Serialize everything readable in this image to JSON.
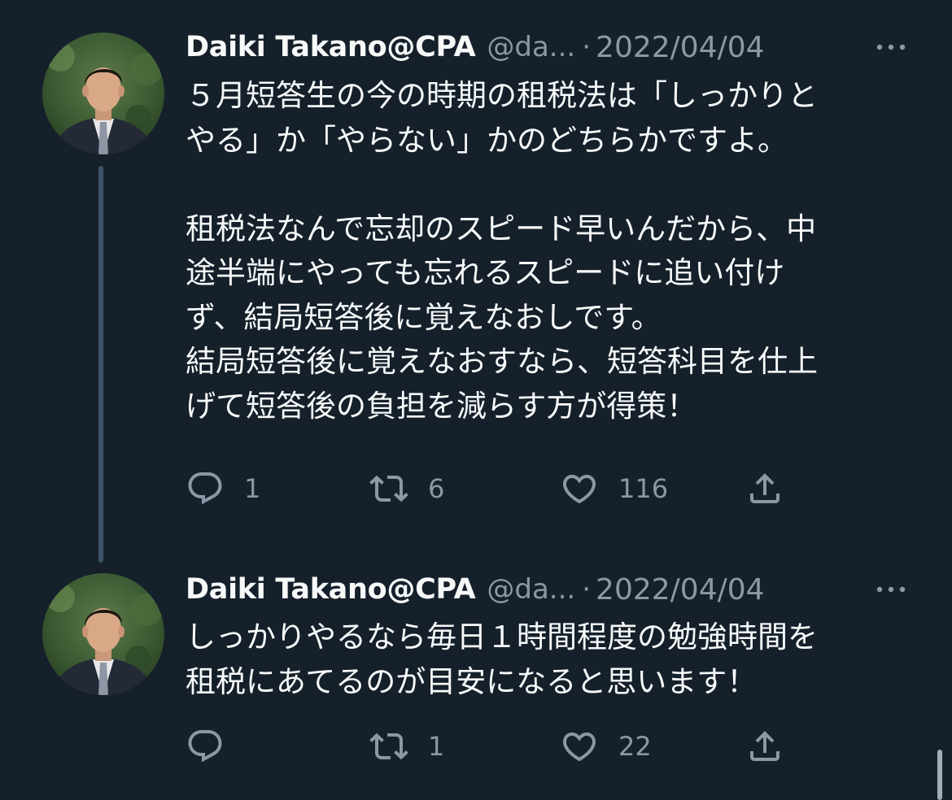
{
  "tweets": [
    {
      "author": {
        "display_name": "Daiki Takano@CPA",
        "handle": "@da...",
        "avatar_icon": "avatar-photo"
      },
      "separator": "·",
      "date": "2022/04/04",
      "text": "５月短答生の今の時期の租税法は「しっかりと\nやる」か「やらない」かのどちらかですよ。\n\n租税法なんで忘却のスピード早いんだから、中\n途半端にやっても忘れるスピードに追い付け\nず、結局短答後に覚えなおしです。\n結局短答後に覚えなおすなら、短答科目を仕上\nげて短答後の負担を減らす方が得策！",
      "replies": "1",
      "retweets": "6",
      "likes": "116"
    },
    {
      "author": {
        "display_name": "Daiki Takano@CPA",
        "handle": "@da...",
        "avatar_icon": "avatar-photo"
      },
      "separator": "·",
      "date": "2022/04/04",
      "text": "しっかりやるなら毎日１時間程度の勉強時間を\n租税にあてるのが目安になると思います！",
      "replies": "",
      "retweets": "1",
      "likes": "22"
    }
  ],
  "icons": {
    "reply": "reply-icon",
    "retweet": "retweet-icon",
    "like": "heart-icon",
    "share": "share-icon",
    "more": "more-icon"
  },
  "colors": {
    "background": "#15202b",
    "text_primary": "#f7f9f9",
    "text_secondary": "#8b98a5",
    "thread_line": "#3d5466"
  }
}
